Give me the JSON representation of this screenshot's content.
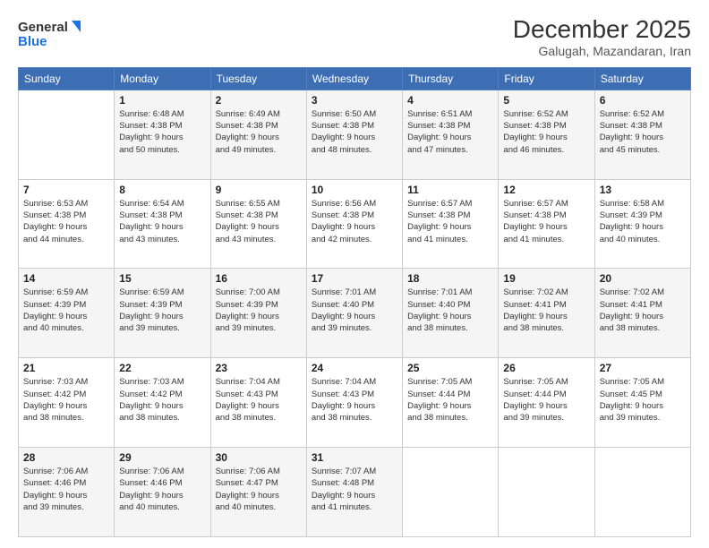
{
  "logo": {
    "line1": "General",
    "line2": "Blue"
  },
  "header": {
    "month": "December 2025",
    "location": "Galugah, Mazandaran, Iran"
  },
  "weekdays": [
    "Sunday",
    "Monday",
    "Tuesday",
    "Wednesday",
    "Thursday",
    "Friday",
    "Saturday"
  ],
  "weeks": [
    [
      {
        "day": "",
        "info": ""
      },
      {
        "day": "1",
        "info": "Sunrise: 6:48 AM\nSunset: 4:38 PM\nDaylight: 9 hours\nand 50 minutes."
      },
      {
        "day": "2",
        "info": "Sunrise: 6:49 AM\nSunset: 4:38 PM\nDaylight: 9 hours\nand 49 minutes."
      },
      {
        "day": "3",
        "info": "Sunrise: 6:50 AM\nSunset: 4:38 PM\nDaylight: 9 hours\nand 48 minutes."
      },
      {
        "day": "4",
        "info": "Sunrise: 6:51 AM\nSunset: 4:38 PM\nDaylight: 9 hours\nand 47 minutes."
      },
      {
        "day": "5",
        "info": "Sunrise: 6:52 AM\nSunset: 4:38 PM\nDaylight: 9 hours\nand 46 minutes."
      },
      {
        "day": "6",
        "info": "Sunrise: 6:52 AM\nSunset: 4:38 PM\nDaylight: 9 hours\nand 45 minutes."
      }
    ],
    [
      {
        "day": "7",
        "info": "Sunrise: 6:53 AM\nSunset: 4:38 PM\nDaylight: 9 hours\nand 44 minutes."
      },
      {
        "day": "8",
        "info": "Sunrise: 6:54 AM\nSunset: 4:38 PM\nDaylight: 9 hours\nand 43 minutes."
      },
      {
        "day": "9",
        "info": "Sunrise: 6:55 AM\nSunset: 4:38 PM\nDaylight: 9 hours\nand 43 minutes."
      },
      {
        "day": "10",
        "info": "Sunrise: 6:56 AM\nSunset: 4:38 PM\nDaylight: 9 hours\nand 42 minutes."
      },
      {
        "day": "11",
        "info": "Sunrise: 6:57 AM\nSunset: 4:38 PM\nDaylight: 9 hours\nand 41 minutes."
      },
      {
        "day": "12",
        "info": "Sunrise: 6:57 AM\nSunset: 4:38 PM\nDaylight: 9 hours\nand 41 minutes."
      },
      {
        "day": "13",
        "info": "Sunrise: 6:58 AM\nSunset: 4:39 PM\nDaylight: 9 hours\nand 40 minutes."
      }
    ],
    [
      {
        "day": "14",
        "info": "Sunrise: 6:59 AM\nSunset: 4:39 PM\nDaylight: 9 hours\nand 40 minutes."
      },
      {
        "day": "15",
        "info": "Sunrise: 6:59 AM\nSunset: 4:39 PM\nDaylight: 9 hours\nand 39 minutes."
      },
      {
        "day": "16",
        "info": "Sunrise: 7:00 AM\nSunset: 4:39 PM\nDaylight: 9 hours\nand 39 minutes."
      },
      {
        "day": "17",
        "info": "Sunrise: 7:01 AM\nSunset: 4:40 PM\nDaylight: 9 hours\nand 39 minutes."
      },
      {
        "day": "18",
        "info": "Sunrise: 7:01 AM\nSunset: 4:40 PM\nDaylight: 9 hours\nand 38 minutes."
      },
      {
        "day": "19",
        "info": "Sunrise: 7:02 AM\nSunset: 4:41 PM\nDaylight: 9 hours\nand 38 minutes."
      },
      {
        "day": "20",
        "info": "Sunrise: 7:02 AM\nSunset: 4:41 PM\nDaylight: 9 hours\nand 38 minutes."
      }
    ],
    [
      {
        "day": "21",
        "info": "Sunrise: 7:03 AM\nSunset: 4:42 PM\nDaylight: 9 hours\nand 38 minutes."
      },
      {
        "day": "22",
        "info": "Sunrise: 7:03 AM\nSunset: 4:42 PM\nDaylight: 9 hours\nand 38 minutes."
      },
      {
        "day": "23",
        "info": "Sunrise: 7:04 AM\nSunset: 4:43 PM\nDaylight: 9 hours\nand 38 minutes."
      },
      {
        "day": "24",
        "info": "Sunrise: 7:04 AM\nSunset: 4:43 PM\nDaylight: 9 hours\nand 38 minutes."
      },
      {
        "day": "25",
        "info": "Sunrise: 7:05 AM\nSunset: 4:44 PM\nDaylight: 9 hours\nand 38 minutes."
      },
      {
        "day": "26",
        "info": "Sunrise: 7:05 AM\nSunset: 4:44 PM\nDaylight: 9 hours\nand 39 minutes."
      },
      {
        "day": "27",
        "info": "Sunrise: 7:05 AM\nSunset: 4:45 PM\nDaylight: 9 hours\nand 39 minutes."
      }
    ],
    [
      {
        "day": "28",
        "info": "Sunrise: 7:06 AM\nSunset: 4:46 PM\nDaylight: 9 hours\nand 39 minutes."
      },
      {
        "day": "29",
        "info": "Sunrise: 7:06 AM\nSunset: 4:46 PM\nDaylight: 9 hours\nand 40 minutes."
      },
      {
        "day": "30",
        "info": "Sunrise: 7:06 AM\nSunset: 4:47 PM\nDaylight: 9 hours\nand 40 minutes."
      },
      {
        "day": "31",
        "info": "Sunrise: 7:07 AM\nSunset: 4:48 PM\nDaylight: 9 hours\nand 41 minutes."
      },
      {
        "day": "",
        "info": ""
      },
      {
        "day": "",
        "info": ""
      },
      {
        "day": "",
        "info": ""
      }
    ]
  ]
}
